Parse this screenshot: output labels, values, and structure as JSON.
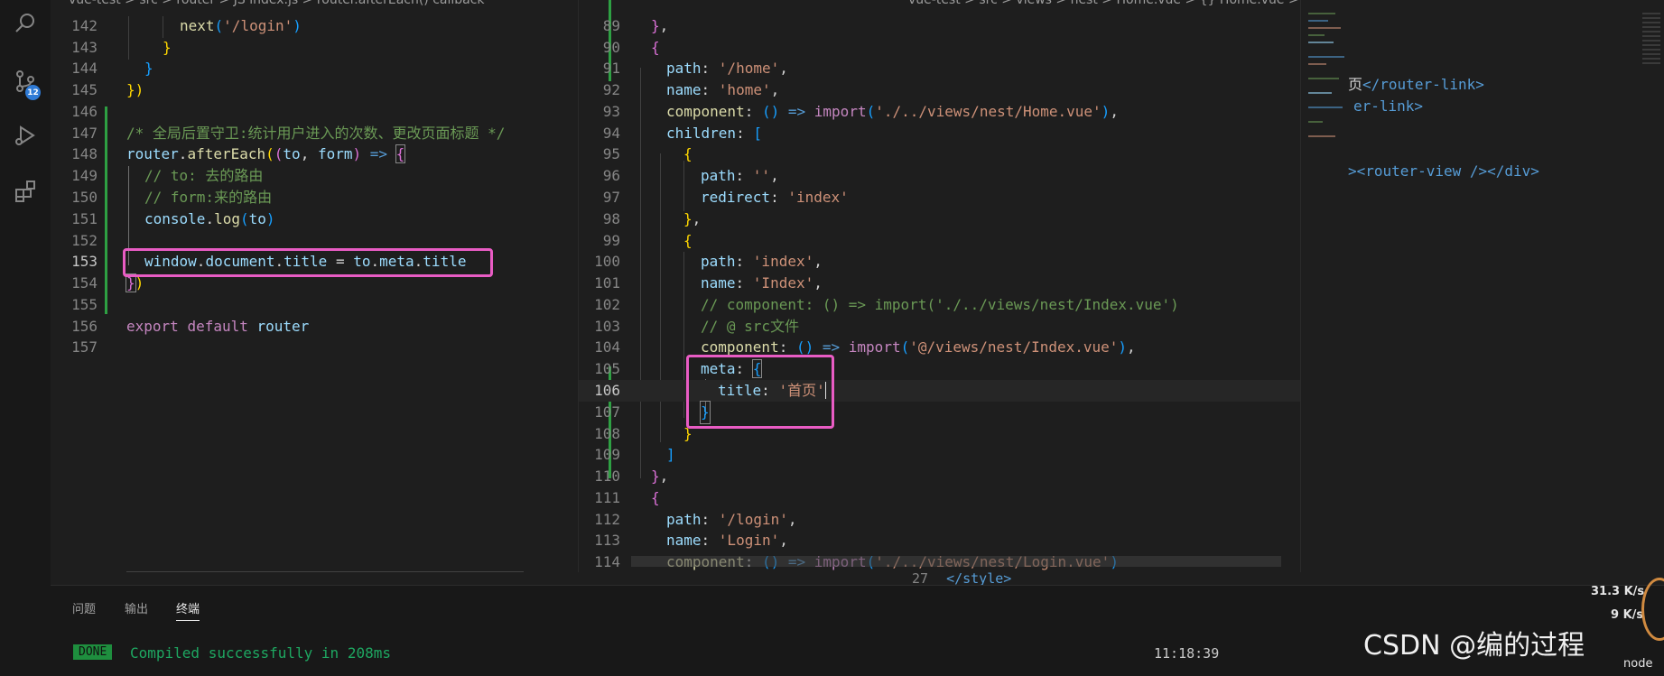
{
  "activity_bar": {
    "scm_badge": "12",
    "icons": [
      "search-icon",
      "source-control-icon",
      "run-debug-icon",
      "extensions-icon"
    ]
  },
  "left_editor": {
    "breadcrumb": "vue-test > src > router > JS index.js > router.afterEach() callback",
    "lines": [
      {
        "n": "142",
        "code": "next('/login')"
      },
      {
        "n": "143",
        "code": "}"
      },
      {
        "n": "144",
        "code": "}"
      },
      {
        "n": "145",
        "code": "})"
      },
      {
        "n": "146",
        "code": ""
      },
      {
        "n": "147",
        "code": "/* 全局后置守卫:统计用户进入的次数、更改页面标题 */"
      },
      {
        "n": "148",
        "code": "router.afterEach((to, form) => {"
      },
      {
        "n": "149",
        "code": "// to: 去的路由"
      },
      {
        "n": "150",
        "code": "// form:来的路由"
      },
      {
        "n": "151",
        "code": "console.log(to)"
      },
      {
        "n": "152",
        "code": ""
      },
      {
        "n": "153",
        "code": "window.document.title = to.meta.title"
      },
      {
        "n": "154",
        "code": "})"
      },
      {
        "n": "155",
        "code": ""
      },
      {
        "n": "156",
        "code": "export default router"
      },
      {
        "n": "157",
        "code": ""
      }
    ]
  },
  "mid_editor": {
    "breadcrumb": "vue-test > src > views > nest > Home.vue > {} Home.vue > template > div",
    "lines": [
      {
        "n": "89",
        "code": "},"
      },
      {
        "n": "90",
        "code": "{"
      },
      {
        "n": "91",
        "code": "path: '/home',"
      },
      {
        "n": "92",
        "code": "name: 'home',"
      },
      {
        "n": "93",
        "code": "component: () => import('./../views/nest/Home.vue'),"
      },
      {
        "n": "94",
        "code": "children: ["
      },
      {
        "n": "95",
        "code": "{"
      },
      {
        "n": "96",
        "code": "path: '',"
      },
      {
        "n": "97",
        "code": "redirect: 'index'"
      },
      {
        "n": "98",
        "code": "},"
      },
      {
        "n": "99",
        "code": "{"
      },
      {
        "n": "100",
        "code": "path: 'index',"
      },
      {
        "n": "101",
        "code": "name: 'Index',"
      },
      {
        "n": "102",
        "code": "// component: () => import('./../views/nest/Index.vue')"
      },
      {
        "n": "103",
        "code": "// @ src文件"
      },
      {
        "n": "104",
        "code": "component: () => import('@/views/nest/Index.vue'),"
      },
      {
        "n": "105",
        "code": "meta: {"
      },
      {
        "n": "106",
        "code": "title: '首页'"
      },
      {
        "n": "107",
        "code": "}"
      },
      {
        "n": "108",
        "code": "}"
      },
      {
        "n": "109",
        "code": "]"
      },
      {
        "n": "110",
        "code": "},"
      },
      {
        "n": "111",
        "code": "{"
      },
      {
        "n": "112",
        "code": "path: '/login',"
      },
      {
        "n": "113",
        "code": "name: 'Login',"
      },
      {
        "n": "114",
        "code": "component: () => import('./../views/nest/Login.vue')"
      }
    ],
    "bottom_line_number": "27",
    "bottom_code": "</style>"
  },
  "right_editor": {
    "fragments": [
      "页</router-link>",
      "er-link>",
      "><router-view /></div>"
    ]
  },
  "panel": {
    "tabs": [
      "问题",
      "输出",
      "终端"
    ],
    "active_tab": "终端",
    "done_label": "DONE",
    "message": "Compiled successfully in 208ms",
    "clock": "11:18:39"
  },
  "overlay": {
    "upload_speed": "31.3 K/s",
    "download_speed": "9 K/s",
    "node_label": "node",
    "watermark": "CSDN @编的过程"
  },
  "colors": {
    "highlight_box": "#e95cc4",
    "done_badge": "#1e8e3e",
    "compiled_text": "#1ea761",
    "modified_gutter": "#2ea043"
  }
}
